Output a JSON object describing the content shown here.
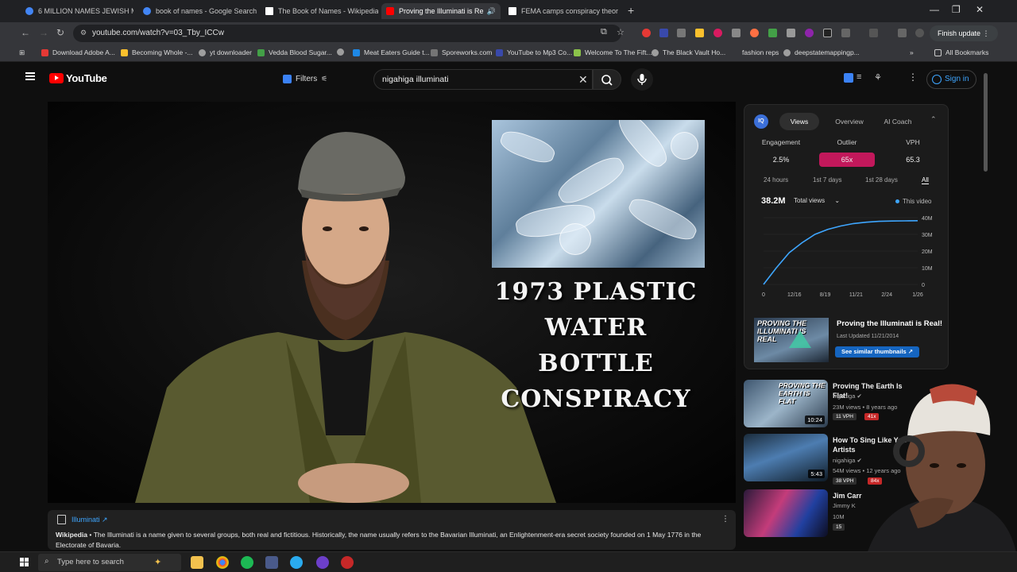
{
  "browser": {
    "tabs": [
      {
        "title": "6 MILLION NAMES JEWISH MU",
        "favicon": "#4285f4"
      },
      {
        "title": "book of names - Google Search",
        "favicon": "#4285f4"
      },
      {
        "title": "The Book of Names - Wikipedia",
        "favicon": "#ffffff"
      },
      {
        "title": "Proving the Illuminati is Re",
        "favicon": "#ff0000",
        "active": true
      },
      {
        "title": "FEMA camps conspiracy theor",
        "favicon": "#ffffff"
      }
    ],
    "url": "youtube.com/watch?v=03_Tby_ICCw",
    "finish_update": "Finish update",
    "bookmarks": [
      {
        "label": "Download Adobe A...",
        "color": "#e53935"
      },
      {
        "label": "Becoming Whole -...",
        "color": "#fbc02d"
      },
      {
        "label": "yt downloader",
        "color": "#9e9e9e"
      },
      {
        "label": "Vedda Blood Sugar...",
        "color": "#43a047"
      },
      {
        "label": "",
        "color": "#9e9e9e"
      },
      {
        "label": "Meat Eaters Guide t...",
        "color": "#1e88e5"
      },
      {
        "label": "Sporeworks.com",
        "color": "#757575"
      },
      {
        "label": "YouTube to Mp3 Co...",
        "color": "#3949ab"
      },
      {
        "label": "Welcome To The Fift...",
        "color": "#8bc34a"
      },
      {
        "label": "The Black Vault Ho...",
        "color": "#9e9e9e"
      },
      {
        "label": "fashion reps",
        "color": "#35363a"
      },
      {
        "label": "deepstatemappingp...",
        "color": "#9e9e9e"
      }
    ],
    "all_bookmarks": "All Bookmarks"
  },
  "youtube": {
    "logo_text": "YouTube",
    "filters_label": "Filters",
    "search_query": "nigahiga illuminati",
    "sign_in": "Sign in"
  },
  "video": {
    "overlay_title": [
      "1973 PLASTIC",
      "WATER BOTTLE",
      "CONSPIRACY"
    ]
  },
  "info_card": {
    "title": "Illuminati",
    "source": "Wikipedia",
    "body": "The Illuminati is a name given to several groups, both real and fictitious. Historically, the name usually refers to the Bavarian Illuminati, an Enlightenment-era secret society founded on 1 May 1776 in the Electorate of Bavaria."
  },
  "analytics": {
    "tabs": [
      "Views",
      "Overview",
      "AI Coach"
    ],
    "stats": [
      {
        "label": "Engagement",
        "value": "2.5%"
      },
      {
        "label": "Outlier",
        "value": "65x",
        "color": "#c2185b"
      },
      {
        "label": "VPH",
        "value": "65.3"
      }
    ],
    "ranges": [
      "24 hours",
      "1st 7 days",
      "1st 28 days",
      "All"
    ],
    "total_views": "38.2M",
    "views_select": "Total views",
    "legend": "This video",
    "promo": {
      "title": "Proving the Illuminati is Real!",
      "date": "Last Updated 11/21/2014",
      "button": "See similar thumbnails",
      "thumb_text": "PROVING THE ILLUMINATI IS REAL"
    }
  },
  "chart_data": {
    "type": "line",
    "series": [
      {
        "values": [
          0,
          10,
          19,
          25,
          30,
          33,
          35,
          36.5,
          37.3,
          37.8,
          38.0,
          38.1,
          38.2
        ]
      }
    ],
    "x_tick_labels": [
      "0",
      "12/16",
      "8/19",
      "11/21",
      "2/24",
      "1/26"
    ],
    "y_tick_labels": [
      "40M",
      "30M",
      "20M",
      "10M",
      "0"
    ],
    "ylim": [
      0,
      40
    ],
    "color": "#3ea6ff"
  },
  "related": [
    {
      "title": "Proving The Earth Is Flat!",
      "channel": "nigahiga",
      "meta": "23M views • 8 years ago",
      "vph": "11 VPH",
      "outlier": "41x",
      "duration": "10:24",
      "thumb_text": "PROVING THE EARTH IS FLAT"
    },
    {
      "title": "How To Sing Like You Artists",
      "channel": "nigahiga",
      "meta": "54M views • 12 years ago",
      "vph": "38 VPH",
      "outlier": "84x",
      "duration": "5:43"
    },
    {
      "title": "Jim Carr",
      "channel": "Jimmy K",
      "meta": "10M",
      "vph": "15",
      "outlier": "",
      "duration": ""
    }
  ],
  "taskbar": {
    "search_placeholder": "Type here to search"
  }
}
